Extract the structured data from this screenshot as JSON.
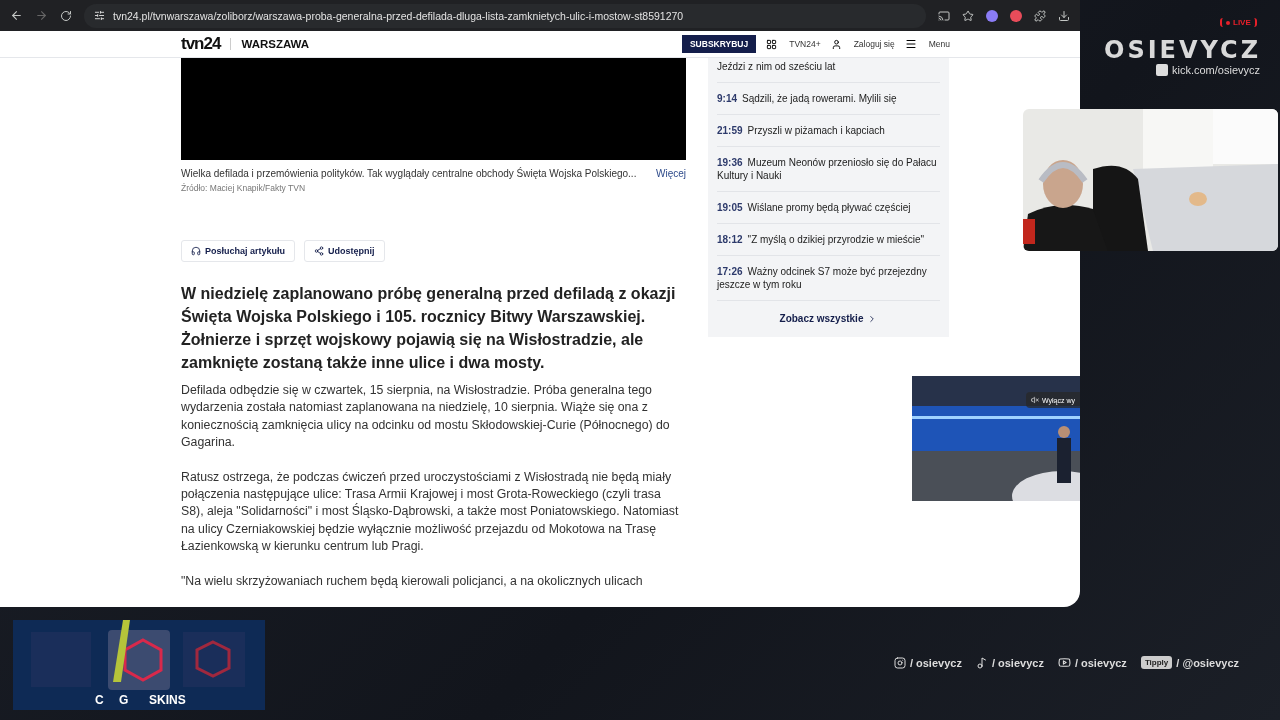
{
  "browser": {
    "url": "tvn24.pl/tvnwarszawa/zoliborz/warszawa-proba-generalna-przed-defilada-dluga-lista-zamknietych-ulic-i-mostow-st8591270"
  },
  "site_header": {
    "logo": "tvn24",
    "section": "WARSZAWA",
    "subscribe": "SUBSKRYBUJ",
    "links": [
      {
        "kind": "grid",
        "label": "TVN24+"
      },
      {
        "kind": "user",
        "label": "Zaloguj się"
      },
      {
        "kind": "menu",
        "label": "Menu"
      }
    ]
  },
  "media": {
    "caption": "Wielka defilada i przemówienia polityków. Tak wyglądały centralne obchody Święta Wojska Polskiego...",
    "more": "Więcej",
    "source": "Źródło: Maciej Knapik/Fakty TVN"
  },
  "actions": [
    {
      "kind": "listen",
      "label": "Posłuchaj artykułu"
    },
    {
      "kind": "share",
      "label": "Udostępnij"
    }
  ],
  "article": {
    "lead": "W niedzielę zaplanowano próbę generalną przed defiladą z okazji Święta Wojska Polskiego i 105. rocznicy Bitwy Warszawskiej. Żołnierze i sprzęt wojskowy pojawią się na Wisłostradzie, ale zamknięte zostaną także inne ulice i dwa mosty.",
    "paragraphs": [
      "Defilada odbędzie się w czwartek, 15 sierpnia, na Wisłostradzie. Próba generalna tego wydarzenia została natomiast zaplanowana na niedzielę, 10 sierpnia. Wiąże się ona z koniecznością zamknięcia ulicy na odcinku od mostu Skłodowskiej-Curie (Północnego) do Gagarina.",
      "Ratusz ostrzega, że podczas ćwiczeń przed uroczystościami z Wisłostradą nie będą miały połączenia następujące ulice: Trasa Armii Krajowej i most Grota-Roweckiego (czyli trasa S8), aleja \"Solidarności\" i most Śląsko-Dąbrowski, a także most Poniatowskiego. Natomiast na ulicy Czerniakowskiej będzie wyłącznie możliwość przejazdu od Mokotowa na Trasę Łazienkowską w kierunku centrum lub Pragi.",
      "\"Na wielu skrzyżowaniach ruchem będą kierowali policjanci, a na okolicznych ulicach"
    ]
  },
  "news": {
    "items": [
      {
        "title": "Jeździ z nim od sześciu lat"
      },
      {
        "time": "9:14",
        "title": "Sądzili, że jadą rowerami. Mylili się"
      },
      {
        "time": "21:59",
        "title": "Przyszli w piżamach i kapciach"
      },
      {
        "time": "19:36",
        "title": "Muzeum Neonów przeniosło się do Pałacu Kultury i Nauki"
      },
      {
        "time": "19:05",
        "title": "Wiślane promy będą pływać częściej"
      },
      {
        "time": "18:12",
        "title": "\"Z myślą o dzikiej przyrodzie w mieście\""
      },
      {
        "time": "17:26",
        "title": "Ważny odcinek S7 może być przejezdny jeszcze w tym roku"
      }
    ],
    "more": "Zobacz wszystkie"
  },
  "video_player": {
    "mute": "Wyłącz wy"
  },
  "stream": {
    "live": "LIVE",
    "name": "OSIEVYCZ",
    "channel": "kick.com/osievycz",
    "sponsor": [
      "C",
      "G",
      "SKINS"
    ],
    "socials": [
      {
        "kind": "instagram",
        "handle": "/ osievycz"
      },
      {
        "kind": "tiktok",
        "handle": "/ osievycz"
      },
      {
        "kind": "youtube",
        "handle": "/ osievycz"
      },
      {
        "kind": "tipply",
        "badge": "Tipply",
        "handle": "/ @osievycz"
      }
    ]
  }
}
